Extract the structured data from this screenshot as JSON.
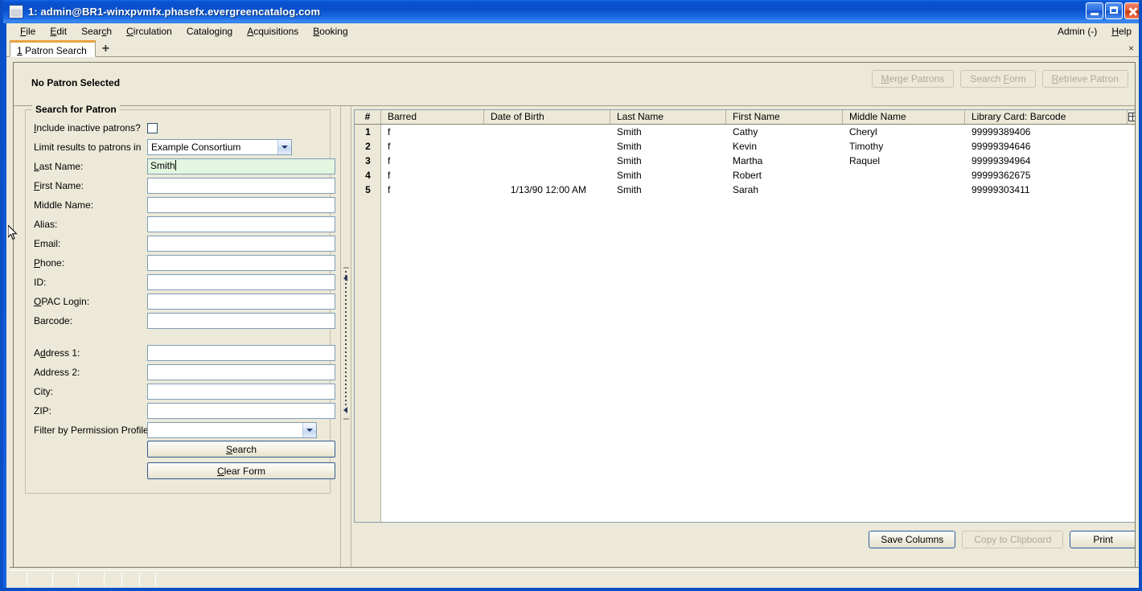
{
  "window": {
    "title": "1: admin@BR1-winxpvmfx.phasefx.evergreencatalog.com",
    "icon": "window-icon",
    "minimize_label": "",
    "maximize_label": "",
    "close_label": ""
  },
  "menubar": {
    "items": [
      {
        "label": "File",
        "accel": "F"
      },
      {
        "label": "Edit",
        "accel": "E"
      },
      {
        "label": "Search",
        "accel": "c"
      },
      {
        "label": "Circulation",
        "accel": "C"
      },
      {
        "label": "Cataloging",
        "accel": "g"
      },
      {
        "label": "Acquisitions",
        "accel": "A"
      },
      {
        "label": "Booking",
        "accel": "B"
      }
    ],
    "right": [
      {
        "label": "Admin (-)"
      },
      {
        "label": "Help",
        "accel": "H"
      }
    ]
  },
  "tabs": {
    "items": [
      {
        "number": "1",
        "label": "Patron Search"
      }
    ],
    "add_label": "+",
    "close_label": "×"
  },
  "patron_header": {
    "status": "No Patron Selected",
    "buttons": [
      {
        "label": "Merge Patrons",
        "enabled": false
      },
      {
        "label": "Search Form",
        "enabled": false
      },
      {
        "label": "Retrieve Patron",
        "enabled": false
      }
    ]
  },
  "search_form": {
    "legend": "Search for Patron",
    "include_inactive": {
      "label": "Include inactive patrons?",
      "checked": false
    },
    "limit_results": {
      "label": "Limit results to patrons in",
      "value": "Example Consortium"
    },
    "fields": [
      {
        "label": "Last Name:",
        "value": "Smith",
        "focused": true
      },
      {
        "label": "First Name:",
        "value": "",
        "focused": false
      },
      {
        "label": "Middle Name:",
        "value": "",
        "focused": false
      },
      {
        "label": "Alias:",
        "value": "",
        "focused": false
      },
      {
        "label": "Email:",
        "value": "",
        "focused": false
      },
      {
        "label": "Phone:",
        "value": "",
        "focused": false
      },
      {
        "label": "ID:",
        "value": "",
        "focused": false
      },
      {
        "label": "OPAC Login:",
        "value": "",
        "focused": false
      },
      {
        "label": "Barcode:",
        "value": "",
        "focused": false
      }
    ],
    "address_fields": [
      {
        "label": "Address 1:",
        "value": ""
      },
      {
        "label": "Address 2:",
        "value": ""
      },
      {
        "label": "City:",
        "value": ""
      },
      {
        "label": "ZIP:",
        "value": ""
      }
    ],
    "permission_profile": {
      "label": "Filter by Permission Profile:",
      "value": ""
    },
    "search_button": "Search",
    "clear_button": "Clear Form"
  },
  "results": {
    "columns": [
      {
        "key": "num",
        "label": "#"
      },
      {
        "key": "barred",
        "label": "Barred"
      },
      {
        "key": "dob",
        "label": "Date of Birth"
      },
      {
        "key": "last",
        "label": "Last Name"
      },
      {
        "key": "first",
        "label": "First Name"
      },
      {
        "key": "middle",
        "label": "Middle Name"
      },
      {
        "key": "card",
        "label": "Library Card: Barcode"
      }
    ],
    "column_picker_icon": "column-picker-icon",
    "rows": [
      {
        "num": "1",
        "barred": "f",
        "dob": "",
        "last": "Smith",
        "first": "Cathy",
        "middle": "Cheryl",
        "card": "99999389406"
      },
      {
        "num": "2",
        "barred": "f",
        "dob": "",
        "last": "Smith",
        "first": "Kevin",
        "middle": "Timothy",
        "card": "99999394646"
      },
      {
        "num": "3",
        "barred": "f",
        "dob": "",
        "last": "Smith",
        "first": "Martha",
        "middle": "Raquel",
        "card": "99999394964"
      },
      {
        "num": "4",
        "barred": "f",
        "dob": "",
        "last": "Smith",
        "first": "Robert",
        "middle": "",
        "card": "99999362675"
      },
      {
        "num": "5",
        "barred": "f",
        "dob": "1/13/90 12:00 AM",
        "last": "Smith",
        "first": "Sarah",
        "middle": "",
        "card": "99999303411"
      }
    ],
    "footer_buttons": [
      {
        "label": "Save Columns",
        "enabled": true,
        "default": true
      },
      {
        "label": "Copy to Clipboard",
        "enabled": false,
        "default": false
      },
      {
        "label": "Print",
        "enabled": true,
        "default": true
      }
    ]
  },
  "colors": {
    "titlebar_blue": "#0a52d0",
    "face": "#ece9d8",
    "tab_accent": "#e8a33d",
    "field_focus_green": "#e3f6e0",
    "field_border": "#7f9db9"
  }
}
